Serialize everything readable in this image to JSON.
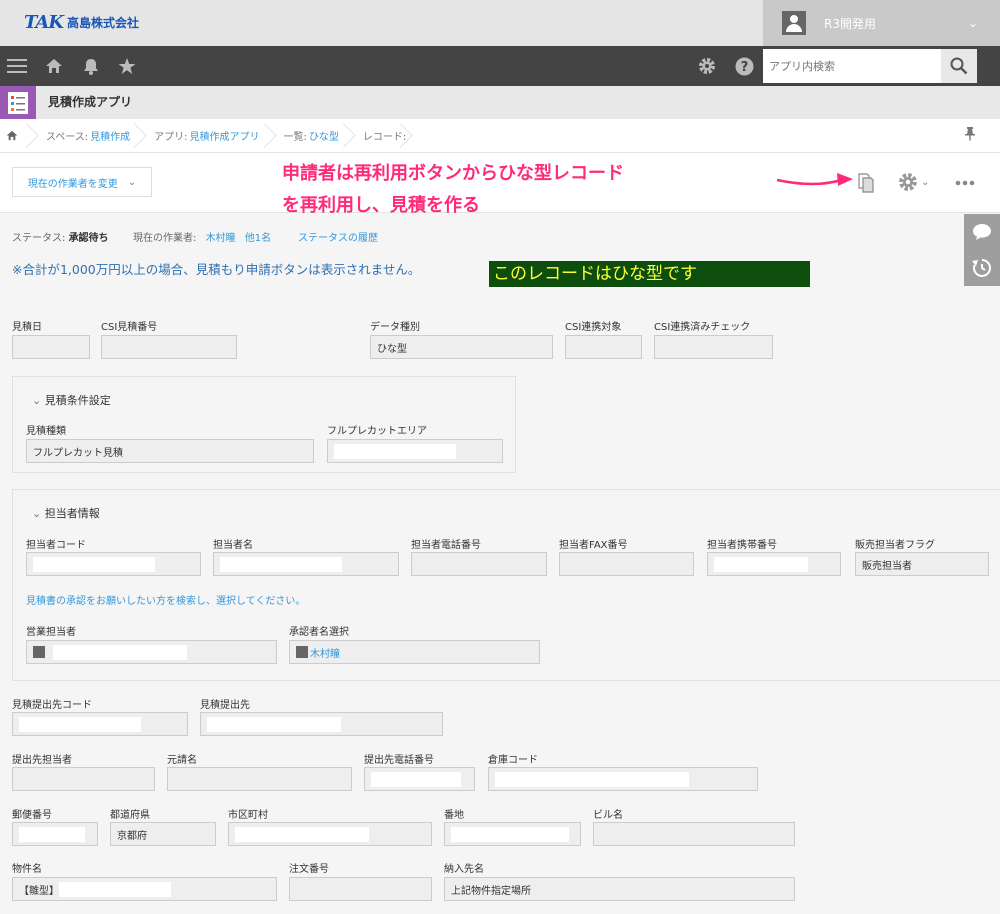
{
  "header": {
    "logo_mark": "TAK",
    "company_name": "高島株式会社",
    "user_name": "R3開発用"
  },
  "nav": {
    "search_placeholder": "アプリ内検索"
  },
  "app": {
    "name": "見積作成アプリ"
  },
  "breadcrumb": {
    "space_label": "スペース:",
    "space_value": "見積作成",
    "app_label": "アプリ:",
    "app_value": "見積作成アプリ",
    "list_label": "一覧:",
    "list_value": "ひな型",
    "record_label": "レコード:"
  },
  "toolbar": {
    "change_assignee": "現在の作業者を変更",
    "annotation_line1": "申請者は再利用ボタンからひな型レコード",
    "annotation_line2": "を再利用し、見積を作る"
  },
  "status": {
    "status_label": "ステータス:",
    "status_value": "承認待ち",
    "worker_label": "現在の作業者:",
    "worker_value": "木村瞳",
    "others": "他1名",
    "history_link": "ステータスの履歴"
  },
  "notice": "※合計が1,000万円以上の場合、見積もり申請ボタンは表示されません。",
  "template_banner": "このレコードはひな型です",
  "fields": {
    "estimate_date": "見積日",
    "csi_estimate_no": "CSI見積番号",
    "data_type": "データ種別",
    "data_type_value": "ひな型",
    "csi_target": "CSI連携対象",
    "csi_check": "CSI連携済みチェック"
  },
  "conditions": {
    "title": "見積条件設定",
    "estimate_type": "見積種類",
    "estimate_type_value": "フルプレカット見積",
    "precut_area": "フルプレカットエリア"
  },
  "staff": {
    "title": "担当者情報",
    "code": "担当者コード",
    "name": "担当者名",
    "phone": "担当者電話番号",
    "fax": "担当者FAX番号",
    "mobile": "担当者携帯番号",
    "flag": "販売担当者フラグ",
    "flag_value": "販売担当者",
    "search_hint": "見積書の承認をお願いしたい方を検索し、選択してください。",
    "sales": "営業担当者",
    "approver": "承認者名選択",
    "approver_value": "木村瞳"
  },
  "submit": {
    "dest_code": "見積提出先コード",
    "dest": "見積提出先",
    "dest_person": "提出先担当者",
    "contractor": "元請名",
    "dest_phone": "提出先電話番号",
    "warehouse": "倉庫コード",
    "postal": "郵便番号",
    "prefecture": "都道府県",
    "prefecture_value": "京都府",
    "city": "市区町村",
    "address": "番地",
    "building": "ビル名",
    "property": "物件名",
    "property_value": "【雛型】",
    "order_no": "注文番号",
    "delivery": "納入先名",
    "delivery_value": "上記物件指定場所"
  }
}
